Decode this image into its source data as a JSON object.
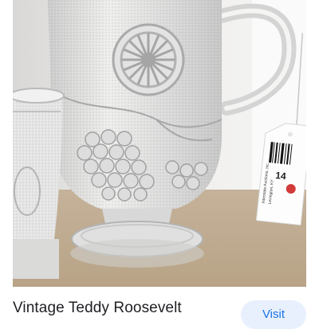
{
  "result": {
    "image_alt": "Vintage Teddy Roosevelt pressed glass pitcher with grape and wagon wheel pattern",
    "title": "Vintage Teddy Roosevelt",
    "visit_label": "Visit"
  },
  "price_tag": {
    "lot_number": "14",
    "lines": [
      "Interstate Auctions, Inc.",
      "Lexington, KY"
    ]
  },
  "colors": {
    "visit_bg": "#e8f0fe",
    "visit_text": "#1a73e8",
    "title_text": "#202124"
  }
}
